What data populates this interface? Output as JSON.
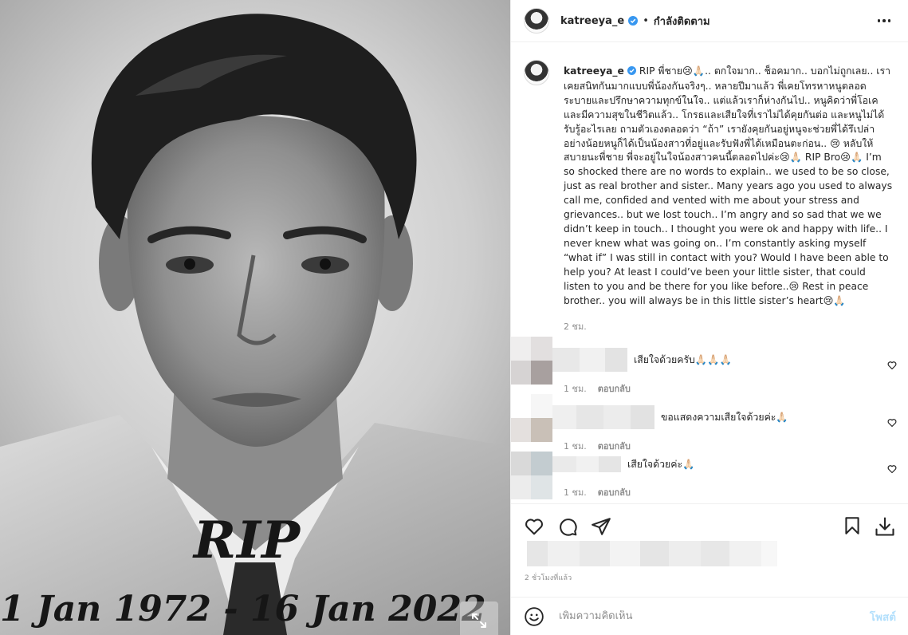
{
  "photo": {
    "overlay_title": "RIP",
    "overlay_dates": "1 Jan 1972 - 16 Jan 2022",
    "expand_icon": "expand-arrows-icon"
  },
  "header": {
    "username": "katreeya_e",
    "separator": "•",
    "follow_status": "กำลังติดตาม",
    "verified_color": "#3897f0",
    "more_icon": "more-options-icon"
  },
  "caption": {
    "username": "katreeya_e",
    "text": "RIP พี่ชาย😢🙏🏻.. ตกใจมาก.. ช็อคมาก.. บอกไม่ถูกเลย.. เราเคยสนิทกันมากแบบพี่น้องกันจริงๆ.. หลายปีมาแล้ว พี่เคยโทรหาหนูตลอด ระบายและปรึกษาความทุกข์ในใจ.. แต่แล้วเราก็ห่างกันไป.. หนูคิดว่าพี่โอเคและมีความสุขในชีวิตแล้ว.. โกรธและเสียใจที่เราไม่ได้คุยกันต่อ และหนูไม่ได้รับรู้อะไรเลย ถามตัวเองตลอดว่า “ถ้า” เรายังคุยกันอยู่หนูจะช่วยพี่ได้รึเปล่า อย่างน้อยหนูก็ได้เป็นน้องสาวที่อยู่และรับฟังพี่ได้เหมือนตะก่อน.. 😢 หลับให้สบายนะพี่ชาย พี่จะอยู่ในใจน้องสาวคนนี้ตลอดไปค่ะ😢🙏🏻 RIP Bro😢🙏🏻 I’m so shocked there are no words to explain.. we used to be so close, just as real brother and sister.. Many years ago you used to always call me, confided and vented with me about your stress and grievances.. but we lost touch.. I’m angry and so sad that we we didn’t keep in touch.. I thought you were ok and happy with life.. I never knew what was going on.. I’m constantly asking myself “what if” I was still in contact with you? Would I have been able to help you? At least I could’ve been your little sister, that could listen to you and be there for you like before..😢 Rest in peace brother.. you will always be in this little sister’s heart😢🙏🏻",
    "time": "2 ชม."
  },
  "comments": [
    {
      "text": "เสียใจด้วยครับ🙏🏻🙏🏻🙏🏻",
      "time": "1 ชม.",
      "reply": "ตอบกลับ"
    },
    {
      "text": "ขอแสดงความเสียใจด้วยค่ะ🙏🏻",
      "time": "1 ชม.",
      "reply": "ตอบกลับ"
    },
    {
      "text": "เสียใจด้วยค่ะ🙏🏻",
      "time": "1 ชม.",
      "reply": "ตอบกลับ"
    }
  ],
  "actions": {
    "icons": [
      "heart-icon",
      "comment-icon",
      "share-icon",
      "bookmark-icon",
      "download-icon"
    ]
  },
  "post_time": "2 ชั่วโมงที่แล้ว",
  "add_comment": {
    "placeholder": "เพิ่มความคิดเห็น",
    "post_label": "โพสต์"
  }
}
